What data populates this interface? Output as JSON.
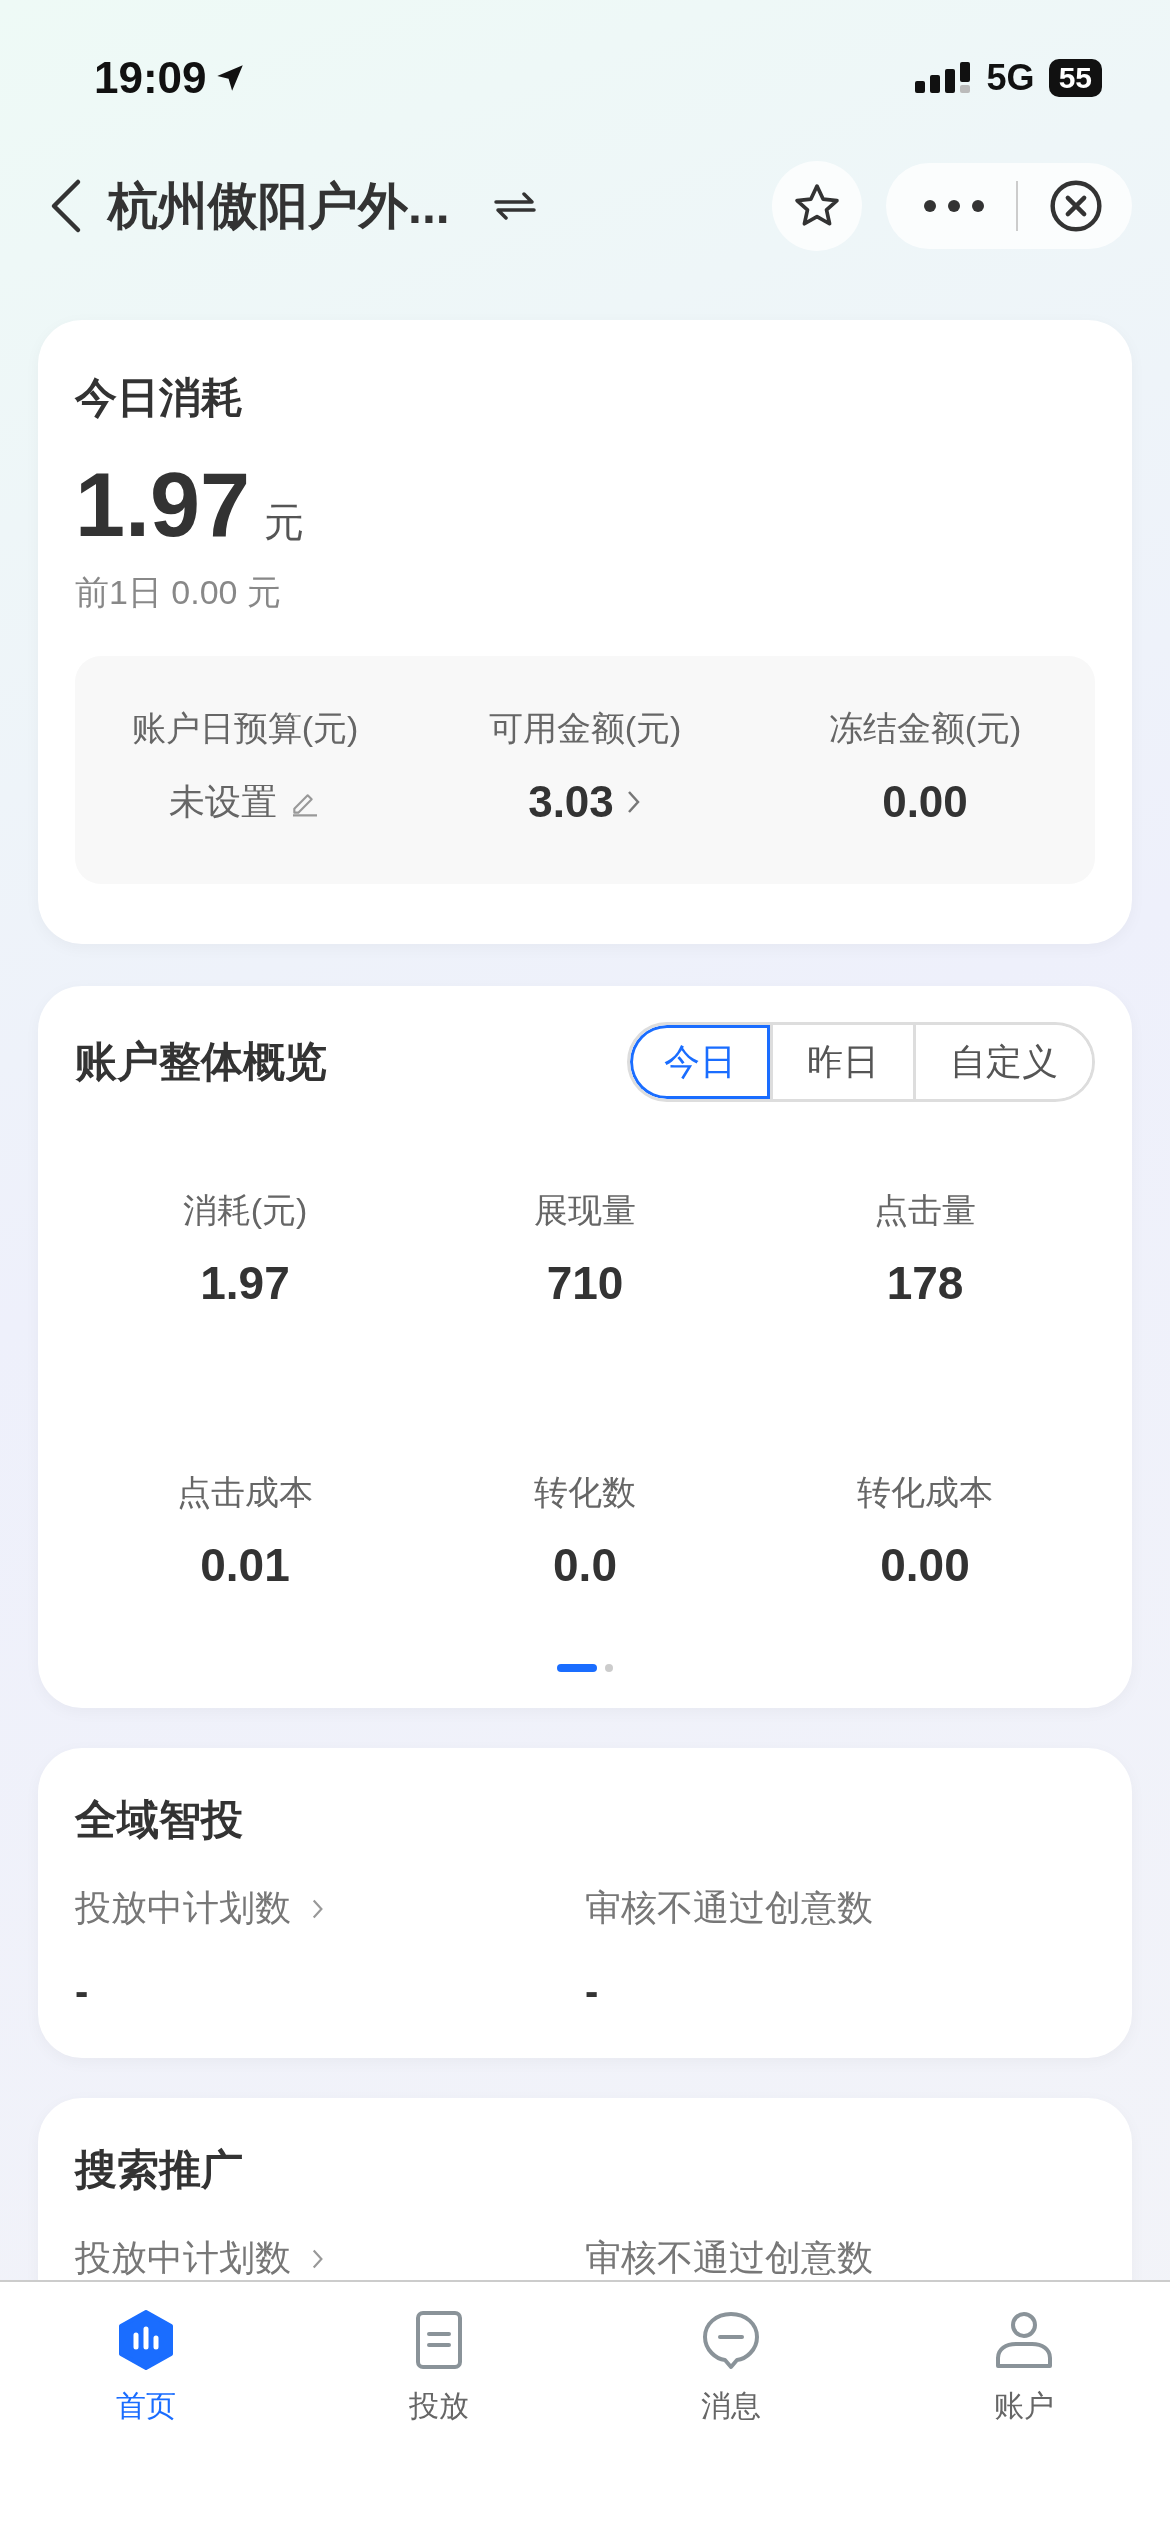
{
  "status_bar": {
    "time": "19:09",
    "network": "5G",
    "battery": "55"
  },
  "nav": {
    "title": "杭州傲阳户外..."
  },
  "today_card": {
    "title": "今日消耗",
    "amount": "1.97",
    "unit": "元",
    "previous": "前1日 0.00 元",
    "stats": [
      {
        "label": "账户日预算(元)",
        "value": "未设置",
        "kind": "editable"
      },
      {
        "label": "可用金额(元)",
        "value": "3.03",
        "kind": "link"
      },
      {
        "label": "冻结金额(元)",
        "value": "0.00",
        "kind": "plain"
      }
    ]
  },
  "overview": {
    "title": "账户整体概览",
    "tabs": [
      {
        "label": "今日",
        "selected": true
      },
      {
        "label": "昨日",
        "selected": false
      },
      {
        "label": "自定义",
        "selected": false
      }
    ],
    "metrics": [
      {
        "label": "消耗(元)",
        "value": "1.97"
      },
      {
        "label": "展现量",
        "value": "710"
      },
      {
        "label": "点击量",
        "value": "178"
      },
      {
        "label": "点击成本",
        "value": "0.01"
      },
      {
        "label": "转化数",
        "value": "0.0"
      },
      {
        "label": "转化成本",
        "value": "0.00"
      }
    ],
    "pages": [
      {
        "selected": true
      },
      {
        "selected": false
      }
    ]
  },
  "sections": [
    {
      "title": "全域智投",
      "items": [
        {
          "label": "投放中计划数",
          "value": "-",
          "link": true
        },
        {
          "label": "审核不通过创意数",
          "value": "-",
          "link": false
        }
      ]
    },
    {
      "title": "搜索推广",
      "items": [
        {
          "label": "投放中计划数",
          "link": true
        },
        {
          "label": "审核不通过创意数",
          "link": false
        }
      ]
    }
  ],
  "tab_bar": [
    {
      "label": "首页",
      "kind": "home",
      "selected": true
    },
    {
      "label": "投放",
      "kind": "doc",
      "selected": false
    },
    {
      "label": "消息",
      "kind": "chat",
      "selected": false
    },
    {
      "label": "账户",
      "kind": "user",
      "selected": false
    }
  ]
}
